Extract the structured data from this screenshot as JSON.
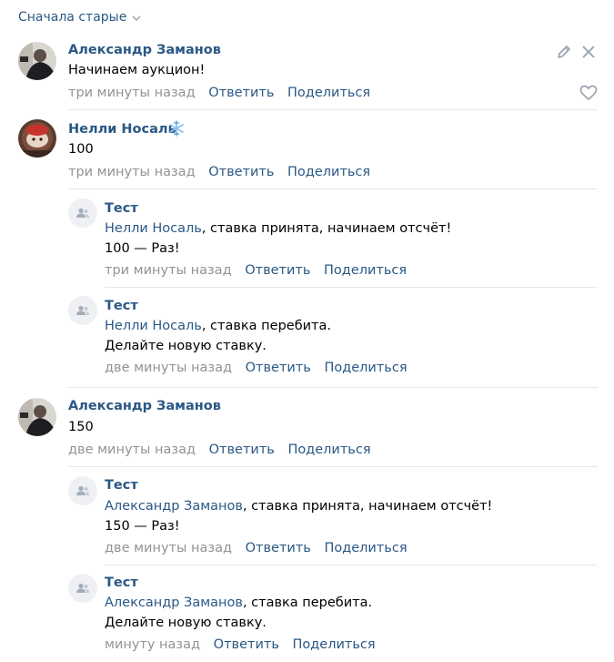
{
  "sort": {
    "label": "Сначала старые"
  },
  "comments": [
    {
      "author": "Александр Заманов",
      "text": "Начинаем аукцион!",
      "time": "три минуты назад",
      "reply": "Ответить",
      "share": "Поделиться"
    },
    {
      "author": "Нелли Носаль",
      "text": "100",
      "time": "три минуты назад",
      "reply": "Ответить",
      "share": "Поделиться",
      "replies": [
        {
          "author": "Тест",
          "mention": "Нелли Носаль",
          "line1": ", ставка принята, начинаем отсчёт!",
          "line2": "100 — Раз!",
          "time": "три минуты назад",
          "reply": "Ответить",
          "share": "Поделиться"
        },
        {
          "author": "Тест",
          "mention": "Нелли Носаль",
          "line1": ", ставка перебита.",
          "line2": "Делайте новую ставку.",
          "time": "две минуты назад",
          "reply": "Ответить",
          "share": "Поделиться"
        }
      ]
    },
    {
      "author": "Александр Заманов",
      "text": "150",
      "time": "две минуты назад",
      "reply": "Ответить",
      "share": "Поделиться",
      "replies": [
        {
          "author": "Тест",
          "mention": "Александр Заманов",
          "line1": ", ставка принята, начинаем отсчёт!",
          "line2": "150 — Раз!",
          "time": "две минуты назад",
          "reply": "Ответить",
          "share": "Поделиться"
        },
        {
          "author": "Тест",
          "mention": "Александр Заманов",
          "line1": ", ставка перебита.",
          "line2": "Делайте новую ставку.",
          "time": "минуту назад",
          "reply": "Ответить",
          "share": "Поделиться"
        }
      ]
    }
  ],
  "icons": {
    "edit": "pencil-icon",
    "delete": "close-icon",
    "like": "heart-icon",
    "status": "snowflake-icon",
    "group_avatar": "community-avatar-icon"
  },
  "colors": {
    "link": "#2a5885",
    "meta": "#939393",
    "separator": "#e7e8ec"
  }
}
